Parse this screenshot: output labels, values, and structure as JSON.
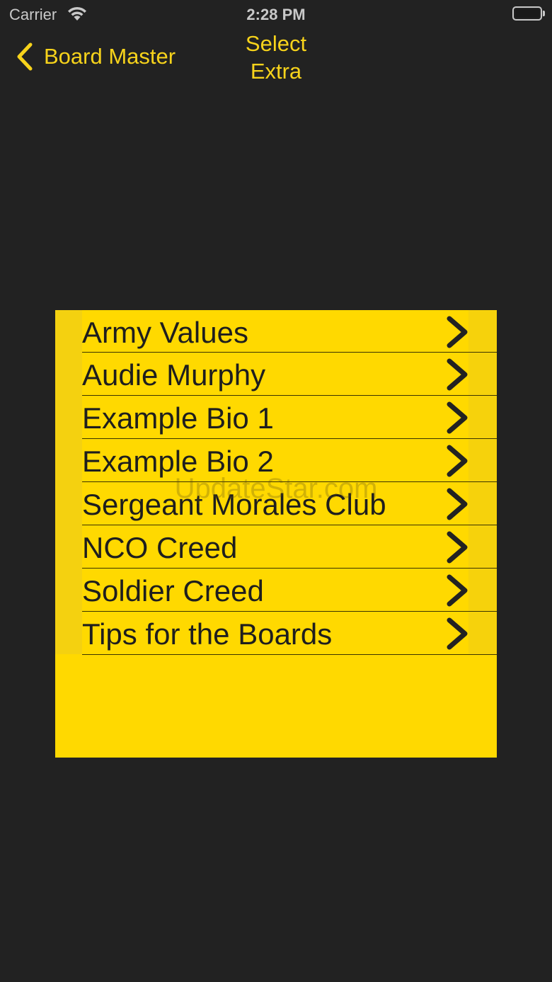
{
  "status_bar": {
    "carrier": "Carrier",
    "time": "2:28 PM",
    "icons": [
      "wifi-icon",
      "battery-icon"
    ]
  },
  "nav": {
    "back_label": "Board Master",
    "title_line1": "Select",
    "title_line2": "Extra"
  },
  "menu": {
    "items": [
      {
        "label": "Army Values"
      },
      {
        "label": "Audie Murphy"
      },
      {
        "label": "Example Bio 1"
      },
      {
        "label": "Example Bio 2"
      },
      {
        "label": "Sergeant Morales Club"
      },
      {
        "label": "NCO Creed"
      },
      {
        "label": "Soldier Creed"
      },
      {
        "label": "Tips for the Boards"
      }
    ]
  },
  "watermark": "UpdateStar.com",
  "colors": {
    "background": "#222222",
    "accent": "#f7d31b",
    "panel": "#ffd900",
    "text": "#1e1e1e"
  }
}
